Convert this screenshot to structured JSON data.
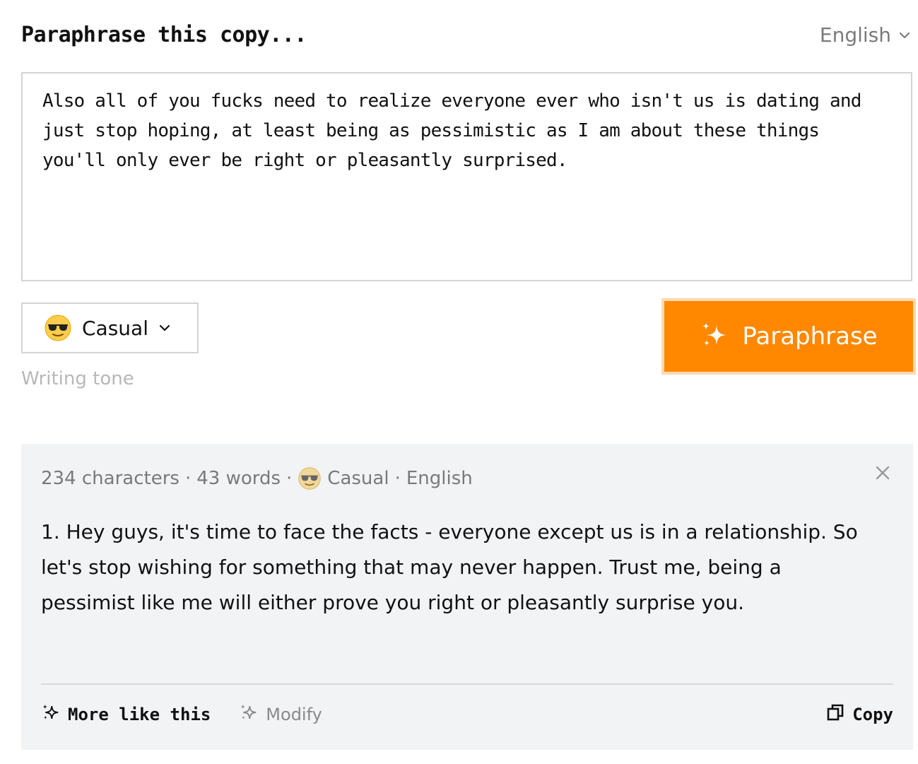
{
  "header": {
    "title": "Paraphrase this copy...",
    "language": "English"
  },
  "input": {
    "text": "Also all of you fucks need to realize everyone ever who isn't us is dating and just stop hoping, at least being as pessimistic as I am about these things you'll only ever be right or pleasantly surprised."
  },
  "tone": {
    "label": "Casual",
    "icon": "sunglasses-emoji-icon",
    "helper": "Writing tone"
  },
  "paraphrase_button": {
    "label": "Paraphrase",
    "icon": "sparkles-icon",
    "color": "#ff8800"
  },
  "result": {
    "meta": {
      "characters": "234 characters",
      "words": "43 words",
      "tone": "Casual",
      "language": "English",
      "separator": "·"
    },
    "output": "1. Hey guys, it's time to face the facts - everyone except us is in a relationship. So let's stop wishing for something that may never happen. Trust me, being a pessimist like me will either prove you right or pleasantly surprise you.",
    "actions": {
      "more_like_this": "More like this",
      "modify": "Modify",
      "copy": "Copy"
    }
  }
}
